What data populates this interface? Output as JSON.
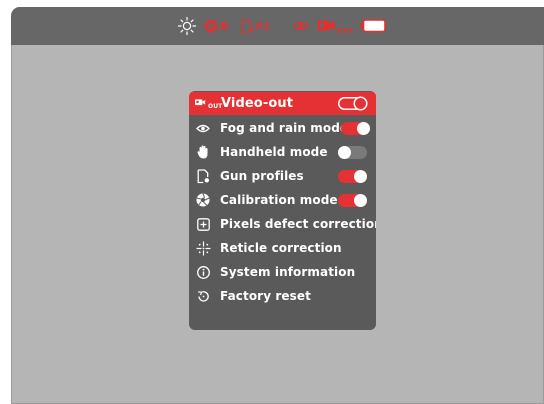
{
  "status_bar": {
    "brightness_icon": "sun-icon",
    "calibration_badge": "B",
    "profile_badge": "G1",
    "eye_icon": "eye-icon",
    "videoout_icon": "camera-out-icon",
    "videoout_sub": "OUT",
    "battery_icon": "battery-icon",
    "accent_color": "#e23030"
  },
  "menu": {
    "items": [
      {
        "label": "Video-out",
        "icon": "camera-out-icon",
        "toggle": "on",
        "selected": true,
        "badge": "OUT"
      },
      {
        "label": "Fog and rain mode",
        "icon": "eye-icon",
        "toggle": "on"
      },
      {
        "label": "Handheld mode",
        "icon": "hand-icon",
        "toggle": "off"
      },
      {
        "label": "Gun profiles",
        "icon": "gun-profile-icon",
        "toggle": "on"
      },
      {
        "label": "Calibration mode",
        "icon": "aperture-icon",
        "toggle": "on"
      },
      {
        "label": "Pixels defect correction",
        "icon": "plus-box-icon"
      },
      {
        "label": "Reticle correction",
        "icon": "crosshair-icon"
      },
      {
        "label": "System information",
        "icon": "info-icon"
      },
      {
        "label": "Factory reset",
        "icon": "reset-icon"
      }
    ],
    "colors": {
      "background": "#5a5a5a",
      "selected": "#e63134",
      "text": "#ffffff"
    }
  }
}
